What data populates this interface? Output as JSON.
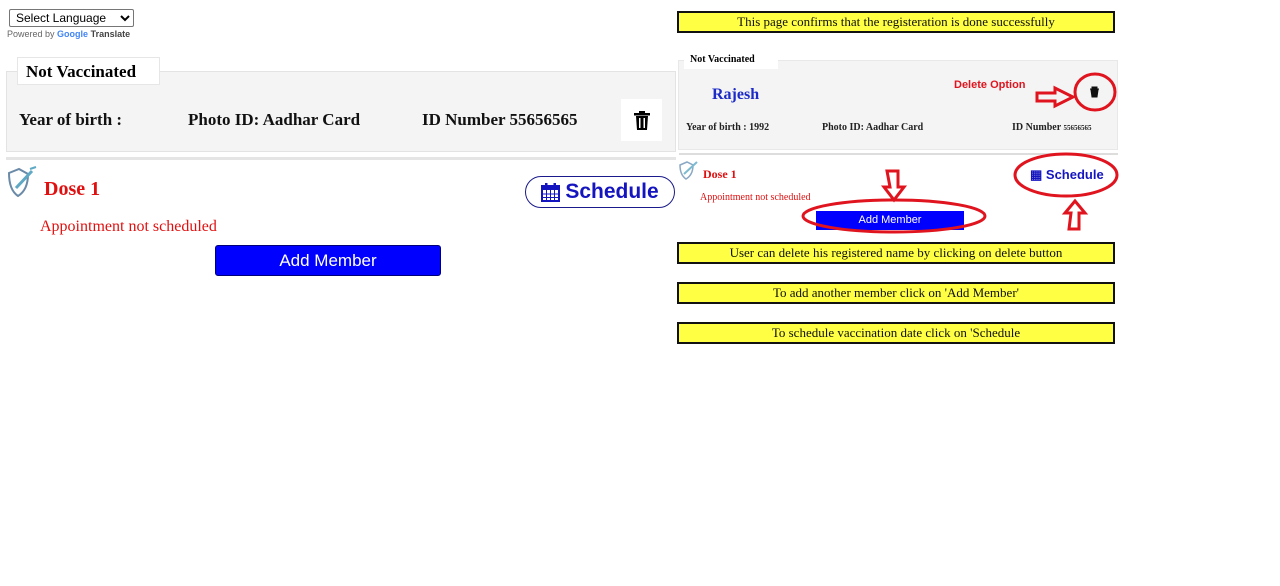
{
  "translate": {
    "select_label": "Select Language",
    "powered_by": "Powered by",
    "google": "Google",
    "translate": "Translate"
  },
  "card": {
    "status_tab": "Not Vaccinated",
    "year_of_birth": "Year of birth :",
    "photo_id": "Photo ID: Aadhar Card",
    "id_number": "ID Number 55656565",
    "delete_icon": "trash-icon"
  },
  "dose": {
    "title": "Dose 1",
    "status": "Appointment not scheduled",
    "schedule_label": "Schedule",
    "add_member_label": "Add Member",
    "icon": "vaccine-shield-icon"
  },
  "annotation": {
    "notes": [
      "This page confirms that the registeration is done successfully",
      "User can delete his registered name by clicking on delete button",
      "To add another member click on 'Add Member'",
      "To schedule vaccination date click on 'Schedule"
    ],
    "status_tab": "Not Vaccinated",
    "name": "Rajesh",
    "delete_option": "Delete Option",
    "year_of_birth": "Year of birth : 1992",
    "photo_id": "Photo ID: Aadhar Card",
    "id_label": "ID Number",
    "id_value": "55656565",
    "dose": "Dose 1",
    "appt": "Appointment not scheduled",
    "schedule": "Schedule",
    "add_member": "Add Member",
    "highlight_color": "#e0141e",
    "note_bg": "#ffff44"
  }
}
